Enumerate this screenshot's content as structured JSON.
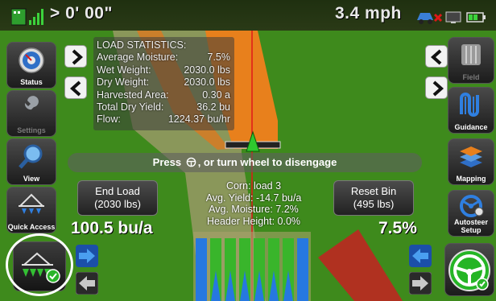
{
  "topbar": {
    "cross_track": "> 0' 00\"",
    "speed": "3.4 mph"
  },
  "left_sidebar": [
    {
      "key": "status",
      "label": "Status",
      "icon": "gauge-icon",
      "enabled": true
    },
    {
      "key": "settings",
      "label": "Settings",
      "icon": "wrench-icon",
      "enabled": false
    },
    {
      "key": "view",
      "label": "View",
      "icon": "magnifier-icon",
      "enabled": true
    },
    {
      "key": "quick_access",
      "label": "Quick Access",
      "icon": "implement-icon",
      "enabled": true
    }
  ],
  "right_sidebar": [
    {
      "key": "field",
      "label": "Field",
      "icon": "field-icon",
      "enabled": false
    },
    {
      "key": "guidance",
      "label": "Guidance",
      "icon": "guidance-icon",
      "enabled": true
    },
    {
      "key": "mapping",
      "label": "Mapping",
      "icon": "map-layers-icon",
      "enabled": true
    },
    {
      "key": "autosteer_setup",
      "label": "Autosteer Setup",
      "icon": "autosteer-icon",
      "enabled": true
    }
  ],
  "load_statistics": {
    "title": "LOAD STATISTICS:",
    "average_moisture": {
      "label": "Average Moisture:",
      "value": "7.5%"
    },
    "wet_weight": {
      "label": "Wet Weight:",
      "value": "2030.0 lbs"
    },
    "dry_weight": {
      "label": "Dry Weight:",
      "value": "2030.0 lbs"
    },
    "harvested_area": {
      "label": "Harvested Area:",
      "value": "0.30 a"
    },
    "total_dry_yield": {
      "label": "Total Dry Yield:",
      "value": "36.2 bu"
    },
    "flow": {
      "label": "Flow:",
      "value": "1224.37 bu/hr"
    }
  },
  "banner": {
    "before": "Press",
    "after": ", or turn wheel to disengage"
  },
  "end_load": {
    "line1": "End Load",
    "line2": "(2030 lbs)"
  },
  "reset_bin": {
    "line1": "Reset Bin",
    "line2": "(495 lbs)"
  },
  "yield_rate": "100.5 bu/a",
  "moisture_readout": "7.5%",
  "center_info": {
    "crop_load": "Corn: load 3",
    "avg_yield": "Avg. Yield: -14.7 bu/a",
    "avg_moisture": "Avg. Moisture: 7.2%",
    "header_height": "Header Height: 0.0%"
  },
  "colors": {
    "field_green": "#3e8a1c",
    "coverage_orange": "#e8801c",
    "worn_path": "#9e9a6a",
    "header_green": "#39b52b",
    "row_blue": "#2678e0",
    "guide_red": "#e01818",
    "autosteer_green": "#25b525"
  }
}
